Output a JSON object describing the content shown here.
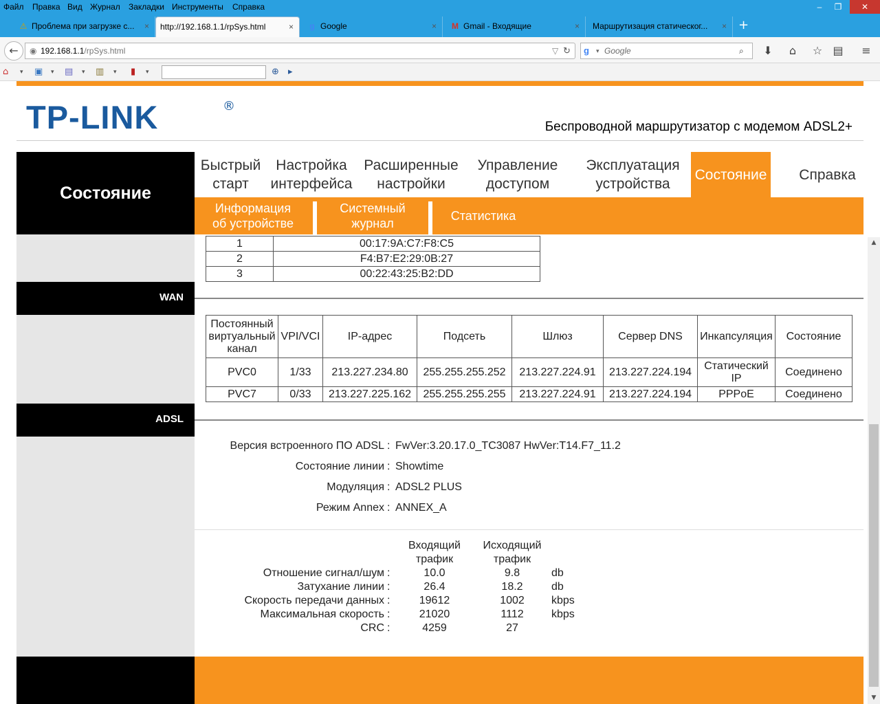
{
  "menubar": {
    "items": [
      "Файл",
      "Правка",
      "Вид",
      "Журнал",
      "Закладки",
      "Инструменты",
      "Справка"
    ],
    "minimize": "–",
    "restore": "❐",
    "close": "✕"
  },
  "tabs": [
    {
      "icon": "⚠",
      "title": "Проблема при загрузке с...",
      "close": "×"
    },
    {
      "icon": "",
      "title": "http://192.168.1.1/rpSys.html",
      "close": "×"
    },
    {
      "icon": "g",
      "title": "Google",
      "close": "×"
    },
    {
      "icon": "M",
      "title": "Gmail - Входящие",
      "close": "×"
    },
    {
      "icon": "",
      "title": "Маршрутизация статическог...",
      "close": "×"
    }
  ],
  "newtab": "+",
  "navbar": {
    "back": "←",
    "url_host": "192.168.1.1",
    "url_path": "/rpSys.html",
    "search_placeholder": "Google",
    "search_engine": "g"
  },
  "router": {
    "brand": "TP-LINK",
    "brand_mark": "®",
    "model_text": "Беспроводной маршрутизатор с модемом ADSL2+",
    "page_title": "Состояние",
    "nav": [
      {
        "l1": "Быстрый",
        "l2": "старт"
      },
      {
        "l1": "Настройка",
        "l2": "интерфейса"
      },
      {
        "l1": "Расширенные",
        "l2": "настройки"
      },
      {
        "l1": "Управление",
        "l2": "доступом"
      },
      {
        "l1": "Эксплуатация",
        "l2": "устройства"
      },
      {
        "l1": "Состояние",
        "l2": ""
      },
      {
        "l1": "Справка",
        "l2": ""
      }
    ],
    "subnav": [
      {
        "l1": "Информация",
        "l2": "об устройстве"
      },
      {
        "l1": "Системный",
        "l2": "журнал"
      },
      {
        "l1": "Статистика",
        "l2": ""
      }
    ]
  },
  "mac_rows": [
    {
      "n": "1",
      "mac": "00:17:9A:C7:F8:C5"
    },
    {
      "n": "2",
      "mac": "F4:B7:E2:29:0B:27"
    },
    {
      "n": "3",
      "mac": "00:22:43:25:B2:DD"
    }
  ],
  "wan": {
    "label": "WAN",
    "headers": [
      "Постоянный виртуальный канал",
      "VPI/VCI",
      "IP-адрес",
      "Подсеть",
      "Шлюз",
      "Сервер DNS",
      "Инкапсуляция",
      "Состояние"
    ],
    "rows": [
      [
        "PVC0",
        "1/33",
        "213.227.234.80",
        "255.255.255.252",
        "213.227.224.91",
        "213.227.224.194",
        "Статический IP",
        "Соединено"
      ],
      [
        "PVC7",
        "0/33",
        "213.227.225.162",
        "255.255.255.255",
        "213.227.224.91",
        "213.227.224.194",
        "PPPoE",
        "Соединено"
      ]
    ]
  },
  "adsl": {
    "label": "ADSL",
    "info": [
      {
        "k": "Версия встроенного ПО ADSL",
        "v": "FwVer:3.20.17.0_TC3087 HwVer:T14.F7_11.2"
      },
      {
        "k": "Состояние линии",
        "v": "Showtime"
      },
      {
        "k": "Модуляция",
        "v": "ADSL2 PLUS"
      },
      {
        "k": "Режим Annex",
        "v": "ANNEX_A"
      }
    ],
    "colon": ":",
    "down_l1": "Входящий",
    "down_l2": "трафик",
    "up_l1": "Исходящий",
    "up_l2": "трафик",
    "stats": [
      {
        "k": "Отношение сигнал/шум",
        "down": "10.0",
        "up": "9.8",
        "unit": "db"
      },
      {
        "k": "Затухание линии",
        "down": "26.4",
        "up": "18.2",
        "unit": "db"
      },
      {
        "k": "Скорость передачи данных",
        "down": "19612",
        "up": "1002",
        "unit": "kbps"
      },
      {
        "k": "Максимальная скорость",
        "down": "21020",
        "up": "1112",
        "unit": "kbps"
      },
      {
        "k": "CRC",
        "down": "4259",
        "up": "27",
        "unit": ""
      }
    ]
  },
  "colors": {
    "accent": "#f7931e",
    "titlebar": "#2aa0e0",
    "brand_blue": "#1a5a9e"
  }
}
